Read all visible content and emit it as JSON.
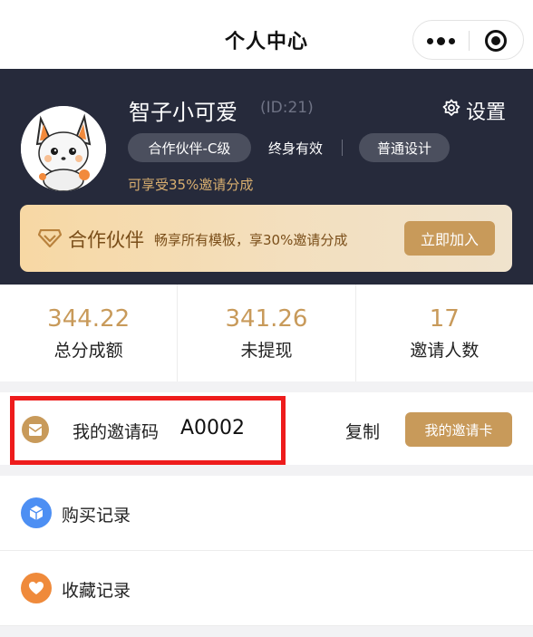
{
  "nav": {
    "title": "个人中心"
  },
  "profile": {
    "name": "智子小可爱",
    "id": "(ID:21)",
    "settings_label": "设置",
    "tags": {
      "partner": "合作伙伴-C级",
      "lifetime": "终身有效",
      "design": "普通设计"
    },
    "share_note": "可享受35%邀请分成"
  },
  "partner_card": {
    "title": "合作伙伴",
    "desc": "畅享所有模板，享30%邀请分成",
    "join_label": "立即加入"
  },
  "stats": [
    {
      "value": "344.22",
      "label": "总分成额"
    },
    {
      "value": "341.26",
      "label": "未提现"
    },
    {
      "value": "17",
      "label": "邀请人数"
    }
  ],
  "invite": {
    "label": "我的邀请码",
    "code": "A0002",
    "copy_label": "复制",
    "card_label": "我的邀请卡"
  },
  "menu": [
    {
      "label": "购买记录",
      "icon": "cube-icon",
      "color": "#4d8ff3"
    },
    {
      "label": "收藏记录",
      "icon": "heart-icon",
      "color": "#ef8a3b"
    }
  ],
  "colors": {
    "header_bg": "#262a3b",
    "accent": "#c89a5a",
    "highlight": "#ee1c1c"
  }
}
